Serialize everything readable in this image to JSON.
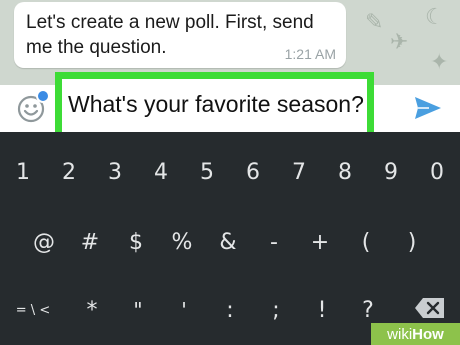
{
  "chat": {
    "message_text": "Let's create a new poll. First, send me the question.",
    "message_time": "1:21 AM"
  },
  "composer": {
    "input_value": "What's your favorite season?",
    "emoji_icon": "emoji-icon",
    "send_icon": "send-icon",
    "highlight_color": "#3ddc36"
  },
  "keyboard": {
    "row1": [
      "1",
      "2",
      "3",
      "4",
      "5",
      "6",
      "7",
      "8",
      "9",
      "0"
    ],
    "row2": [
      "@",
      "#",
      "$",
      "%",
      "&",
      "-",
      "+",
      "(",
      ")"
    ],
    "row3": [
      "= \\ <",
      "*",
      "\"",
      "'",
      ":",
      ";",
      "!",
      "?"
    ],
    "delete_icon": "backspace-icon"
  },
  "watermark": {
    "prefix": "wiki",
    "suffix": "How"
  }
}
